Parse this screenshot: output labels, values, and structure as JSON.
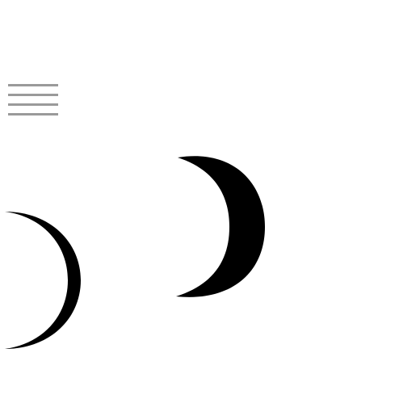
{
  "icons": {
    "menu": "hamburger-menu-icon",
    "crescent_small": "crescent-moon-icon",
    "crescent_large": "crescent-moon-icon"
  },
  "colors": {
    "background": "#ffffff",
    "menu_lines": "#9a9a9a",
    "crescent_fill": "#000000"
  }
}
